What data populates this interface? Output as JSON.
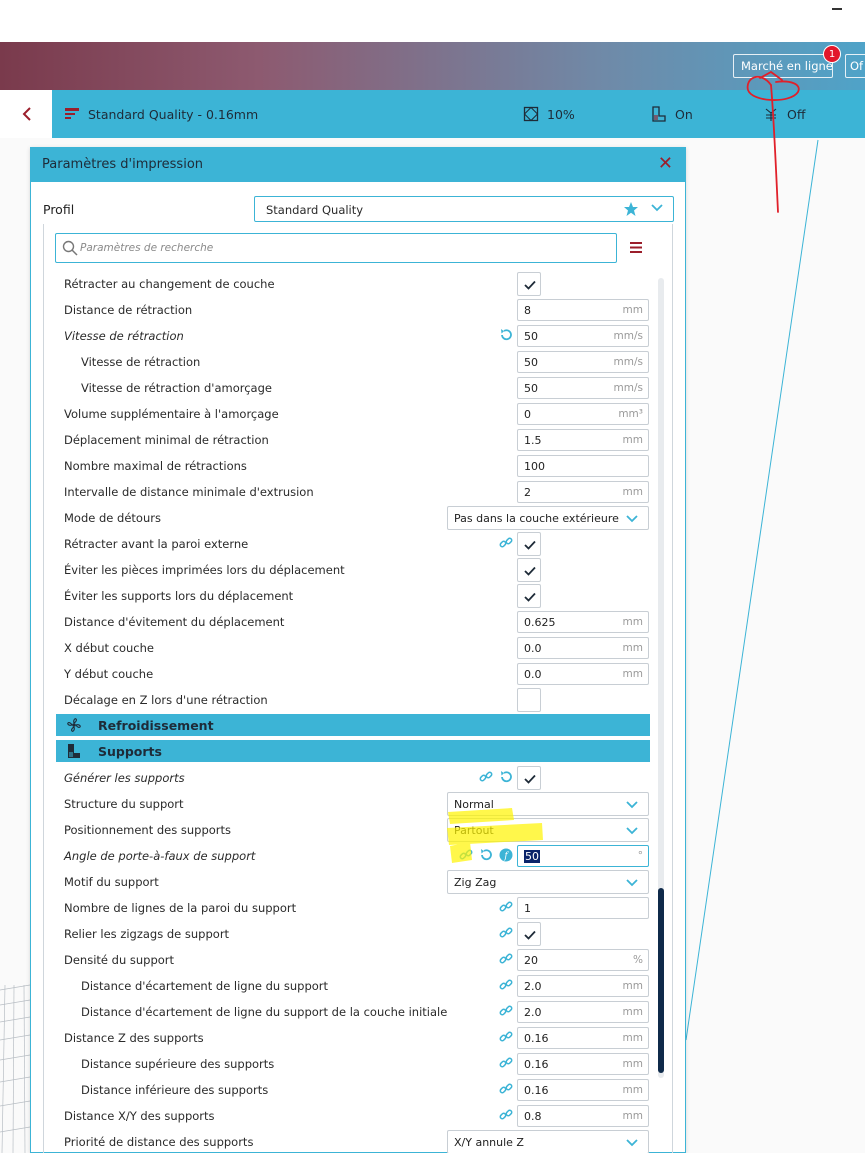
{
  "header": {
    "marketplace_label": "Marché en ligne",
    "other_label": "Of",
    "notification_count": "1"
  },
  "toolbar": {
    "profile": "Standard Quality - 0.16mm",
    "infill": "10%",
    "support": "On",
    "adhesion": "Off"
  },
  "panel": {
    "title": "Paramètres d'impression",
    "profile_label": "Profil",
    "profile_value": "Standard Quality",
    "search_placeholder": "Paramètres de recherche"
  },
  "rows": {
    "r0": {
      "label": "Rétracter au changement de couche"
    },
    "r1": {
      "label": "Distance de rétraction",
      "value": "8",
      "unit": "mm"
    },
    "r2": {
      "label": "Vitesse de rétraction",
      "value": "50",
      "unit": "mm/s"
    },
    "r3": {
      "label": "Vitesse de rétraction",
      "value": "50",
      "unit": "mm/s"
    },
    "r4": {
      "label": "Vitesse de rétraction d'amorçage",
      "value": "50",
      "unit": "mm/s"
    },
    "r5": {
      "label": "Volume supplémentaire à l'amorçage",
      "value": "0",
      "unit": "mm³"
    },
    "r6": {
      "label": "Déplacement minimal de rétraction",
      "value": "1.5",
      "unit": "mm"
    },
    "r7": {
      "label": "Nombre maximal de rétractions",
      "value": "100",
      "unit": ""
    },
    "r8": {
      "label": "Intervalle de distance minimale d'extrusion",
      "value": "2",
      "unit": "mm"
    },
    "r9": {
      "label": "Mode de détours",
      "value": "Pas dans la couche extérieure"
    },
    "r10": {
      "label": "Rétracter avant la paroi externe"
    },
    "r11": {
      "label": "Éviter les pièces imprimées lors du déplacement"
    },
    "r12": {
      "label": "Éviter les supports lors du déplacement"
    },
    "r13": {
      "label": "Distance d'évitement du déplacement",
      "value": "0.625",
      "unit": "mm"
    },
    "r14": {
      "label": "X début couche",
      "value": "0.0",
      "unit": "mm"
    },
    "r15": {
      "label": "Y début couche",
      "value": "0.0",
      "unit": "mm"
    },
    "r16": {
      "label": "Décalage en Z lors d'une rétraction"
    },
    "r17": {
      "label": "Générer les supports"
    },
    "r18": {
      "label": "Structure du support",
      "value": "Normal"
    },
    "r19": {
      "label": "Positionnement des supports",
      "value": "Partout"
    },
    "r20": {
      "label": "Angle de porte-à-faux de support",
      "value": "50",
      "unit": "°"
    },
    "r21": {
      "label": "Motif du support",
      "value": "Zig Zag"
    },
    "r22": {
      "label": "Nombre de lignes de la paroi du support",
      "value": "1",
      "unit": ""
    },
    "r23": {
      "label": "Relier les zigzags de support"
    },
    "r24": {
      "label": "Densité du support",
      "value": "20",
      "unit": "%"
    },
    "r25": {
      "label": "Distance d'écartement de ligne du support",
      "value": "2.0",
      "unit": "mm"
    },
    "r26": {
      "label": "Distance d'écartement de ligne du support de la couche initiale",
      "value": "2.0",
      "unit": "mm"
    },
    "r27": {
      "label": "Distance Z des supports",
      "value": "0.16",
      "unit": "mm"
    },
    "r28": {
      "label": "Distance supérieure des supports",
      "value": "0.16",
      "unit": "mm"
    },
    "r29": {
      "label": "Distance inférieure des supports",
      "value": "0.16",
      "unit": "mm"
    },
    "r30": {
      "label": "Distance X/Y des supports",
      "value": "0.8",
      "unit": "mm"
    },
    "r31": {
      "label": "Priorité de distance des supports",
      "value": "X/Y annule Z"
    }
  },
  "categories": {
    "cooling": "Refroidissement",
    "supports": "Supports"
  },
  "colors": {
    "accent": "#3cb4d6",
    "brand": "#9b1e2b",
    "highlight": "#fff500",
    "annotation": "#e0202a"
  },
  "icons": [
    "chevron-left-icon",
    "profile-icon",
    "infill-icon",
    "support-icon",
    "adhesion-icon",
    "close-icon",
    "star-icon",
    "chevron-down-icon",
    "search-icon",
    "menu-icon",
    "check-icon",
    "link-icon",
    "reset-icon",
    "function-icon",
    "fan-icon"
  ]
}
